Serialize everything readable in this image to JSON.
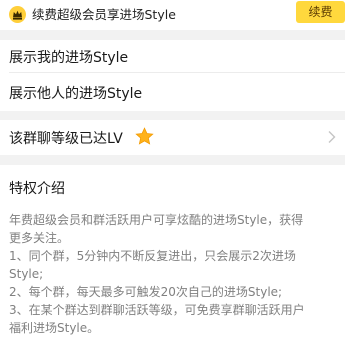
{
  "banner": {
    "icon": "crown-icon",
    "title": "续费超级会员享进场Style",
    "renew_label": "续费",
    "accent_color": "#ffd83d"
  },
  "settings": {
    "show_mine_label": "展示我的进场Style",
    "show_others_label": "展示他人的进场Style",
    "group_level_label": "该群聊等级已达LV",
    "group_level_icon": "star-icon"
  },
  "privilege": {
    "heading": "特权介绍",
    "lines": [
      "年费超级会员和群活跃用户可享炫酷的进场Style，获得",
      "更多关注。",
      "1、同个群，5分钟内不断反复进出，只会展示2次进场",
      "Style;",
      "2、每个群，每天最多可触发20次自己的进场Style;",
      "3、在某个群达到群聊活跃等级，可免费享群聊活跃用户",
      "福利进场Style。"
    ]
  }
}
